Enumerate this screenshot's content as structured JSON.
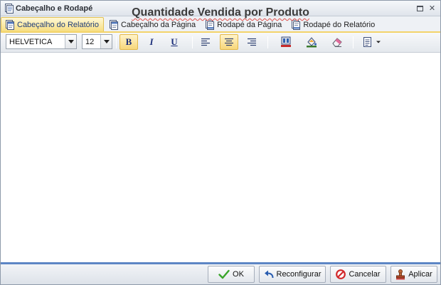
{
  "window": {
    "title": "Cabeçalho e Rodapé",
    "controls": [
      "maximize-icon",
      "close-icon"
    ]
  },
  "tabs": [
    {
      "label": "Cabeçalho do Relatório",
      "active": true,
      "icon": "header-page-icon"
    },
    {
      "label": "Cabeçalho da Página",
      "active": false,
      "icon": "header-page-icon"
    },
    {
      "label": "Rodapé da Página",
      "active": false,
      "icon": "footer-page-icon"
    },
    {
      "label": "Rodapé do Relatório",
      "active": false,
      "icon": "footer-page-icon"
    }
  ],
  "toolbar": {
    "font_family": "HELVETICA",
    "font_size": "12",
    "bold_glyph": "B",
    "italic_glyph": "I",
    "underline_glyph": "U",
    "bold_active": true,
    "align_selected": "center",
    "icons": [
      "bold-icon",
      "italic-icon",
      "underline-icon",
      "align-left-icon",
      "align-center-icon",
      "align-right-icon",
      "text-color-icon",
      "fill-color-icon",
      "eraser-icon",
      "insert-field-icon"
    ]
  },
  "editor": {
    "content": "Quantidade Vendida por Produto"
  },
  "footer": {
    "ok_label": "OK",
    "reconfigure_label": "Reconfigurar",
    "cancel_label": "Cancelar",
    "apply_label": "Aplicar"
  },
  "colors": {
    "active_tab": "#f6dc7d",
    "footer_accent": "#5d86c5",
    "heading_text": "#3b3b3b",
    "spellcheck_underline": "#e0504b"
  }
}
